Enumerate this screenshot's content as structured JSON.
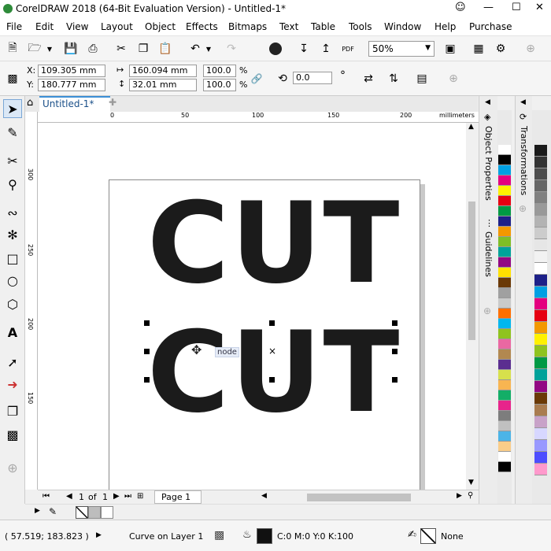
{
  "app": {
    "title": "CorelDRAW 2018 (64-Bit Evaluation Version) - Untitled-1*"
  },
  "menu": [
    "File",
    "Edit",
    "View",
    "Layout",
    "Object",
    "Effects",
    "Bitmaps",
    "Text",
    "Table",
    "Tools",
    "Window",
    "Help",
    "Purchase"
  ],
  "toolbar": {
    "zoom": "50%",
    "pdf_label": "PDF"
  },
  "props": {
    "x_label": "X:",
    "x": "109.305 mm",
    "y_label": "Y:",
    "y": "180.777 mm",
    "w": "160.094 mm",
    "h": "32.01 mm",
    "sx": "100.0",
    "sy": "100.0",
    "pct1": "%",
    "pct2": "%",
    "rotation": "0.0",
    "deg": "°"
  },
  "doc": {
    "tab": "Untitled-1*",
    "ruler_unit": "millimeters",
    "ruler_ticks": [
      "0",
      "50",
      "100",
      "150",
      "200"
    ],
    "ruler_left_ticks": [
      "300",
      "250",
      "200",
      "150"
    ]
  },
  "canvas": {
    "text_top": "CUT",
    "text_bottom": "CUT",
    "tooltip": "node",
    "center_mark": "×"
  },
  "pager": {
    "current": "1",
    "of": "of",
    "total": "1",
    "page_tab": "Page 1"
  },
  "dockers": {
    "object_properties": "Object Properties",
    "guidelines": "Guidelines",
    "transformations": "Transformations"
  },
  "status": {
    "coords": "( 57.519; 183.823 )",
    "layer": "Curve on Layer 1",
    "fill": "C:0 M:0 Y:0 K:100",
    "outline": "None"
  },
  "palette": [
    "#ffffff",
    "#000000",
    "#00a0e3",
    "#e4007f",
    "#fff100",
    "#e60012",
    "#009944",
    "#1d2088",
    "#f39800",
    "#7fbe26",
    "#00a29a",
    "#920783",
    "#ffe100",
    "#6a3906",
    "#a0a0a0",
    "#c9caca",
    "#ff6f00",
    "#00b7ee",
    "#8fc31f",
    "#ea68a2",
    "#b28850",
    "#5b2e90",
    "#d7e04c",
    "#f8b551",
    "#13ae67",
    "#e7248b",
    "#7d7d7d",
    "#c0c0c0",
    "#4cb4e7",
    "#facd89",
    "#ffffff",
    "#000000"
  ],
  "palette2": [
    "#1a1a1a",
    "#333333",
    "#4d4d4d",
    "#666666",
    "#808080",
    "#999999",
    "#b3b3b3",
    "#cccccc",
    "#e6e6e6",
    "#f2f2f2",
    "#ffffff",
    "#1d2088",
    "#00a0e3",
    "#e4007f",
    "#e60012",
    "#f39800",
    "#fff100",
    "#8fc31f",
    "#009944",
    "#00a29a",
    "#920783",
    "#6a3906",
    "#a97c50",
    "#c8a2c8",
    "#d7d7ff",
    "#9999ff",
    "#4d4dff",
    "#ff99cc"
  ]
}
